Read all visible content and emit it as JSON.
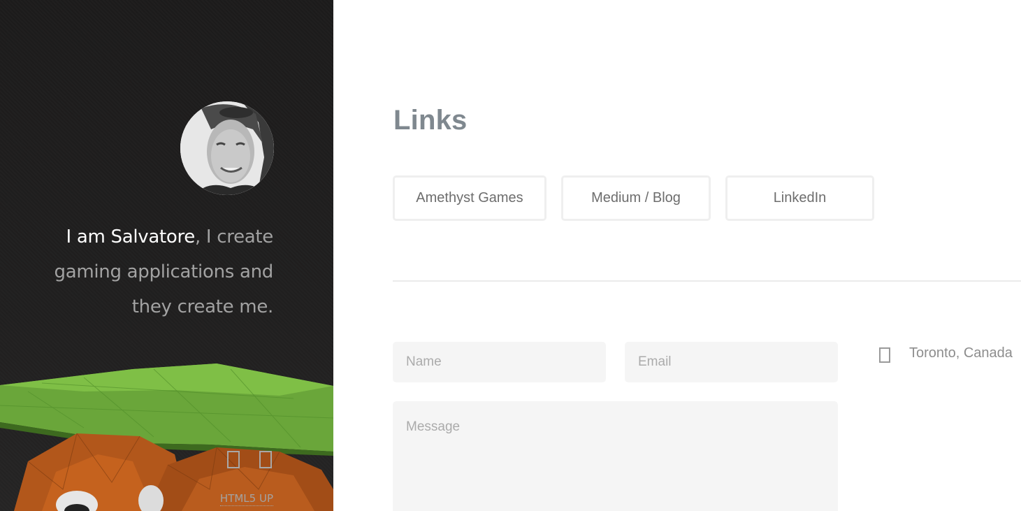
{
  "sidebar": {
    "bio_name": "I am Salvatore",
    "bio_rest": ", I create gaming applications and they create me.",
    "social_icons": [
      "social-icon-1",
      "social-icon-2"
    ],
    "credit": "HTML5 UP"
  },
  "main": {
    "section_title": "Links",
    "links": [
      {
        "label": "Amethyst Games"
      },
      {
        "label": "Medium / Blog"
      },
      {
        "label": "LinkedIn"
      }
    ],
    "form": {
      "name_placeholder": "Name",
      "email_placeholder": "Email",
      "message_placeholder": "Message"
    },
    "location": {
      "icon": "map-marker-icon",
      "text": "Toronto, Canada"
    }
  },
  "colors": {
    "sidebar_bg": "#1e1d1d",
    "heading": "#7f888f",
    "field_bg": "#f5f5f5",
    "button_border": "#efefef"
  }
}
